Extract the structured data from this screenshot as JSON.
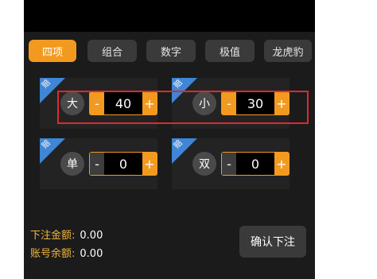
{
  "tabs": [
    "四项",
    "组合",
    "数字",
    "极值",
    "龙虎豹"
  ],
  "corner_badge": "赔",
  "bets": [
    {
      "label": "大",
      "value": "40",
      "minus": "-",
      "plus": "+"
    },
    {
      "label": "小",
      "value": "30",
      "minus": "-",
      "plus": "+"
    },
    {
      "label": "单",
      "value": "0",
      "minus": "-",
      "plus": "+"
    },
    {
      "label": "双",
      "value": "0",
      "minus": "-",
      "plus": "+"
    }
  ],
  "summary": {
    "bet_amount_label": "下注金额:",
    "bet_amount_value": "0.00",
    "balance_label": "账号余额:",
    "balance_value": "0.00"
  },
  "confirm_label": "确认下注",
  "colors": {
    "accent": "#f29a1f",
    "badge": "#3f86d6",
    "highlight": "#e0282f"
  }
}
